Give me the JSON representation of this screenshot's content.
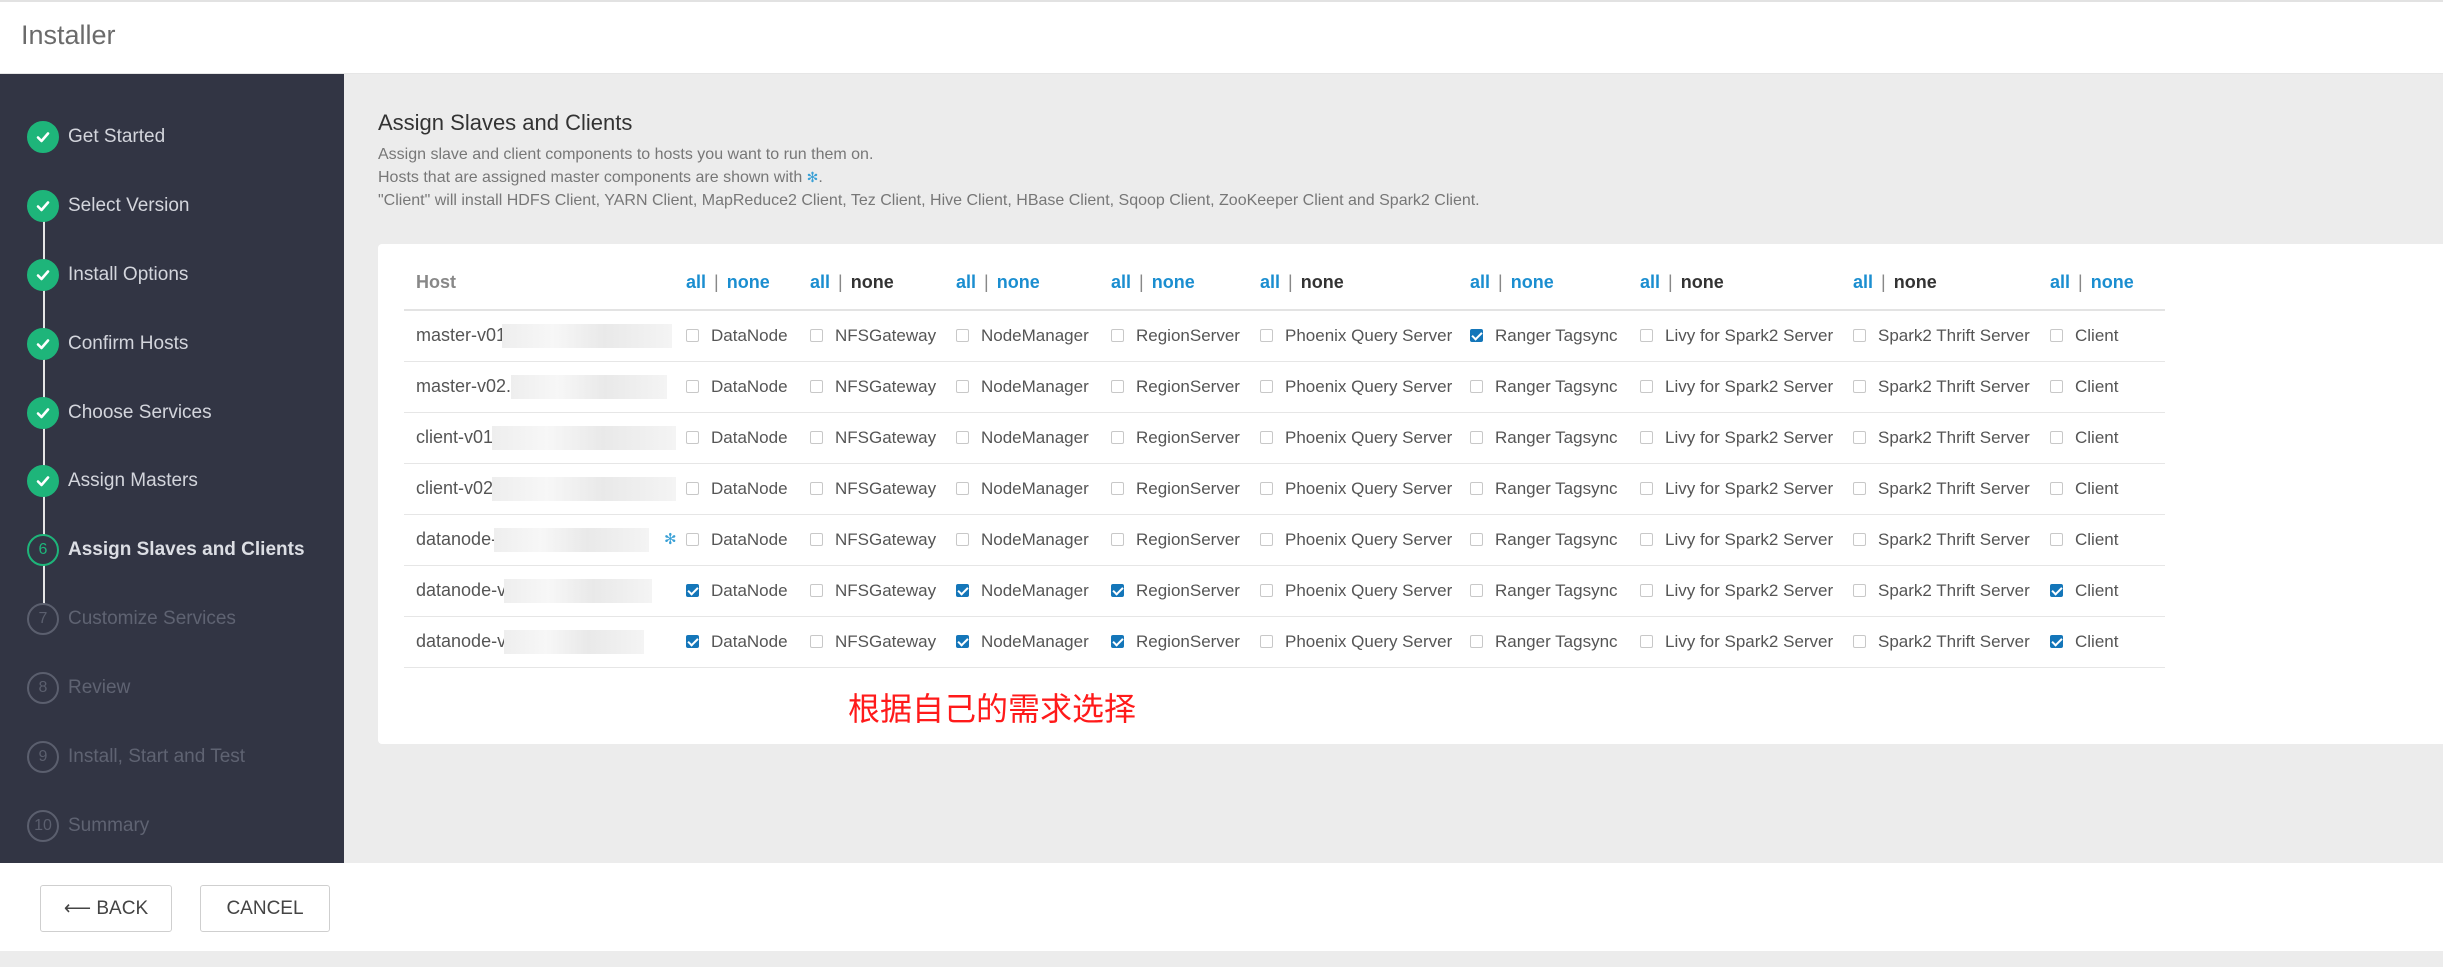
{
  "app": {
    "title": "Installer"
  },
  "steps": [
    {
      "num": "1",
      "label": "Get Started",
      "state": "done"
    },
    {
      "num": "2",
      "label": "Select Version",
      "state": "done"
    },
    {
      "num": "3",
      "label": "Install Options",
      "state": "done"
    },
    {
      "num": "4",
      "label": "Confirm Hosts",
      "state": "done"
    },
    {
      "num": "5",
      "label": "Choose Services",
      "state": "done"
    },
    {
      "num": "6",
      "label": "Assign Masters",
      "state": "done"
    },
    {
      "num": "6",
      "label": "Assign Slaves and Clients",
      "state": "current"
    },
    {
      "num": "7",
      "label": "Customize Services",
      "state": "todo"
    },
    {
      "num": "8",
      "label": "Review",
      "state": "todo"
    },
    {
      "num": "9",
      "label": "Install, Start and Test",
      "state": "todo"
    },
    {
      "num": "10",
      "label": "Summary",
      "state": "todo"
    }
  ],
  "main": {
    "title": "Assign Slaves and Clients",
    "desc1": "Assign slave and client components to hosts you want to run them on.",
    "desc2": "Hosts that are assigned master components are shown with",
    "desc2_end": ".",
    "desc3": "\"Client\" will install HDFS Client, YARN Client, MapReduce2 Client, Tez Client, Hive Client, HBase Client, Sqoop Client, ZooKeeper Client and Spark2 Client."
  },
  "table": {
    "host_header": "Host",
    "all_label": "all",
    "none_label": "none",
    "separator": "|",
    "columns": [
      {
        "name": "DataNode",
        "all_active": true,
        "none_active": true
      },
      {
        "name": "NFSGateway",
        "all_active": true,
        "none_active": false
      },
      {
        "name": "NodeManager",
        "all_active": true,
        "none_active": true
      },
      {
        "name": "RegionServer",
        "all_active": true,
        "none_active": true
      },
      {
        "name": "Phoenix Query Server",
        "all_active": true,
        "none_active": false
      },
      {
        "name": "Ranger Tagsync",
        "all_active": true,
        "none_active": true
      },
      {
        "name": "Livy for Spark2 Server",
        "all_active": true,
        "none_active": false
      },
      {
        "name": "Spark2 Thrift Server",
        "all_active": true,
        "none_active": false
      },
      {
        "name": "Client",
        "all_active": true,
        "none_active": true
      }
    ],
    "rows": [
      {
        "host": "master-v01",
        "master": false,
        "checks": [
          false,
          false,
          false,
          false,
          false,
          true,
          false,
          false,
          false
        ]
      },
      {
        "host": "master-v02.v",
        "master": false,
        "checks": [
          false,
          false,
          false,
          false,
          false,
          false,
          false,
          false,
          false
        ]
      },
      {
        "host": "client-v01",
        "master": false,
        "checks": [
          false,
          false,
          false,
          false,
          false,
          false,
          false,
          false,
          false
        ]
      },
      {
        "host": "client-v02.",
        "master": false,
        "checks": [
          false,
          false,
          false,
          false,
          false,
          false,
          false,
          false,
          false
        ]
      },
      {
        "host": "datanode-v",
        "master": true,
        "checks": [
          false,
          false,
          false,
          false,
          false,
          false,
          false,
          false,
          false
        ]
      },
      {
        "host": "datanode-v0",
        "master": false,
        "checks": [
          true,
          false,
          true,
          true,
          false,
          false,
          false,
          false,
          true
        ]
      },
      {
        "host": "datanode-v0",
        "master": false,
        "checks": [
          true,
          false,
          true,
          true,
          false,
          false,
          false,
          false,
          true
        ]
      }
    ]
  },
  "annotation": "根据自己的需求选择",
  "footer": {
    "back_label": "⟵ BACK",
    "cancel_label": "CANCEL"
  },
  "colors": {
    "accent_green": "#1eb57a",
    "link_blue": "#1b8ed0",
    "check_blue": "#1476b9",
    "sidebar_bg": "#323544",
    "annotation_red": "#ff1a1a"
  }
}
